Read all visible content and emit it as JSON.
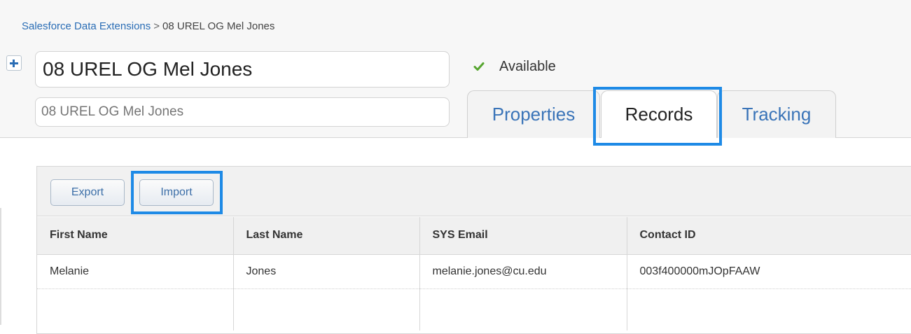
{
  "breadcrumb": {
    "root": "Salesforce Data Extensions",
    "separator": ">",
    "current": "08 UREL OG Mel Jones"
  },
  "header": {
    "name_value": "08 UREL OG Mel Jones",
    "description_placeholder": "08 UREL OG Mel Jones",
    "status": "Available",
    "icons": {
      "add": "plus-icon",
      "status": "check-icon"
    },
    "colors": {
      "link": "#2a6db5",
      "status_check": "#56a52f",
      "highlight": "#1e8ae6"
    }
  },
  "tabs": [
    {
      "label": "Properties",
      "active": false
    },
    {
      "label": "Records",
      "active": true
    },
    {
      "label": "Tracking",
      "active": false
    }
  ],
  "toolbar": {
    "export_label": "Export",
    "import_label": "Import"
  },
  "table": {
    "columns": [
      "First Name",
      "Last Name",
      "SYS Email",
      "Contact ID"
    ],
    "rows": [
      [
        "Melanie",
        "Jones",
        "melanie.jones@cu.edu",
        "003f400000mJOpFAAW"
      ]
    ]
  }
}
